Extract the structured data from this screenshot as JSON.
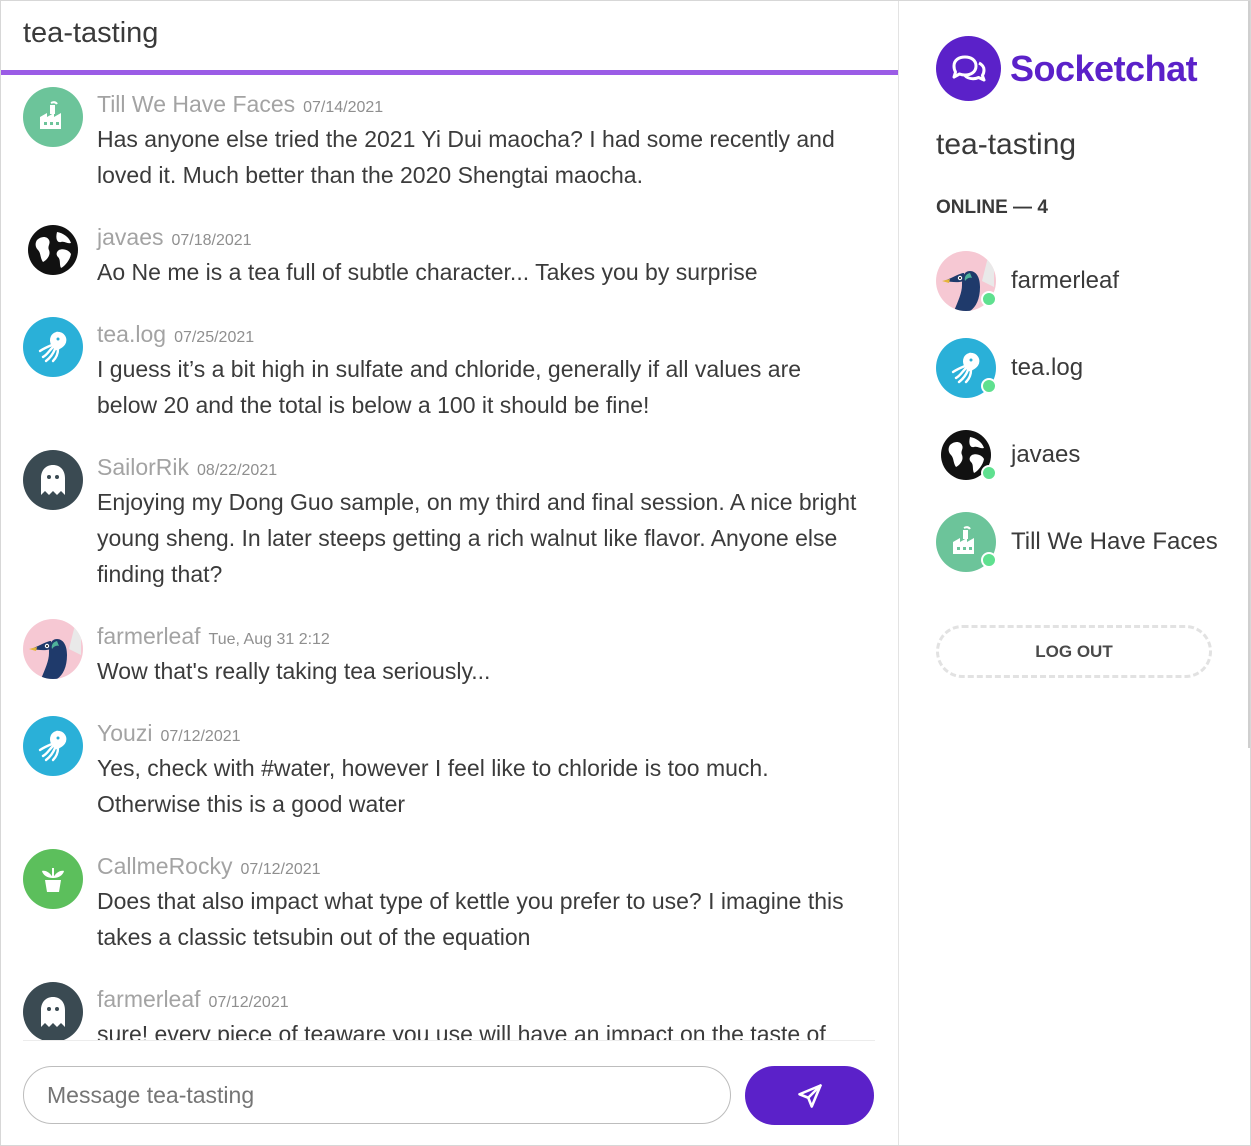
{
  "channel": {
    "name": "tea-tasting"
  },
  "messages": [
    {
      "user": "Till We Have Faces",
      "time": "07/14/2021",
      "text": "Has anyone else tried the 2021 Yi Dui maocha? I had some recently and loved it. Much better than the 2020 Shengtai maocha.",
      "avatar": "factory-icon",
      "avatar_bg": "#6cc49a"
    },
    {
      "user": "javaes",
      "time": "07/18/2021",
      "text": "Ao Ne me is a tea full of subtle character... Takes you by surprise",
      "avatar": "globe-icon",
      "avatar_bg": "#ffffff"
    },
    {
      "user": "tea.log",
      "time": "07/25/2021",
      "text": "I guess it’s a bit high in sulfate and chloride, generally if all values are below 20 and the total is below a 100 it should be fine!",
      "avatar": "octopus-icon",
      "avatar_bg": "#2ab0d8"
    },
    {
      "user": "SailorRik",
      "time": "08/22/2021",
      "text": "Enjoying my Dong Guo sample, on my third and final session. A nice bright young sheng. In later steeps getting a rich walnut like flavor. Anyone else finding that?",
      "avatar": "ghost-icon",
      "avatar_bg": "#3a4a52"
    },
    {
      "user": "farmerleaf",
      "time": "Tue, Aug 31 2:12",
      "text": "Wow that's really taking tea seriously...",
      "avatar": "peacock-icon",
      "avatar_bg": "#f6c8d3"
    },
    {
      "user": "Youzi",
      "time": "07/12/2021",
      "text": "Yes, check with #water, however I feel like to chloride is too much. Otherwise this is a good water",
      "avatar": "octopus-icon",
      "avatar_bg": "#2ab0d8"
    },
    {
      "user": "CallmeRocky",
      "time": "07/12/2021",
      "text": "Does that also impact what type of kettle you prefer to use? I imagine this takes a classic tetsubin out of the equation",
      "avatar": "plant-pot-icon",
      "avatar_bg": "#5cbf5c"
    },
    {
      "user": "farmerleaf",
      "time": "07/12/2021",
      "text": "sure! every piece of teaware you use will have an impact on the taste of",
      "avatar": "ghost-icon",
      "avatar_bg": "#3a4a52"
    }
  ],
  "composer": {
    "placeholder": "Message tea-tasting",
    "send_icon": "paper-plane-icon"
  },
  "sidebar": {
    "brand": "Socketchat",
    "brand_icon": "chat-bubbles-icon",
    "brand_color": "#5b21c9",
    "channel": "tea-tasting",
    "online_label": "ONLINE — 4",
    "online_users": [
      {
        "name": "farmerleaf",
        "avatar": "peacock-icon",
        "avatar_bg": "#f6c8d3"
      },
      {
        "name": "tea.log",
        "avatar": "octopus-icon",
        "avatar_bg": "#2ab0d8"
      },
      {
        "name": "javaes",
        "avatar": "globe-icon",
        "avatar_bg": "#ffffff"
      },
      {
        "name": "Till We Have Faces",
        "avatar": "factory-icon",
        "avatar_bg": "#6cc49a"
      }
    ],
    "logout_label": "LOG OUT"
  }
}
